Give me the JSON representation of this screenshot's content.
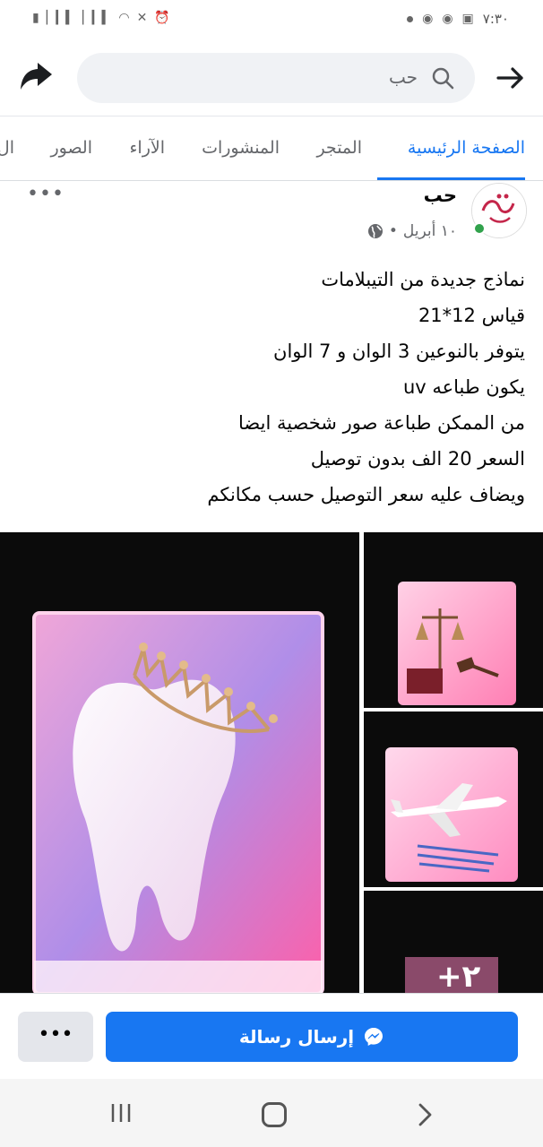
{
  "status_bar": {
    "time": "٧:٣٠"
  },
  "search": {
    "query": "حب"
  },
  "tabs": [
    {
      "label": "الصفحة الرئيسية",
      "active": true
    },
    {
      "label": "المتجر",
      "active": false
    },
    {
      "label": "المنشورات",
      "active": false
    },
    {
      "label": "الآراء",
      "active": false
    },
    {
      "label": "الصور",
      "active": false
    },
    {
      "label": "ال",
      "active": false
    }
  ],
  "post": {
    "page_name": "حب",
    "date": "١٠ أبريل",
    "separator": "•",
    "text_lines": [
      "نماذج جديدة من التيبلامات",
      "قياس  12*21",
      "يتوفر بالنوعين 3 الوان و 7 الوان",
      "يكون طباعه uv",
      "من الممكن طباعة صور شخصية ايضا",
      "السعر 20 الف بدون توصيل",
      "ويضاف عليه سعر التوصيل حسب مكانكم"
    ],
    "more_photos_label": "+٢"
  },
  "actions": {
    "send_message_label": "إرسال رسالة",
    "more_label": "•••"
  },
  "colors": {
    "accent": "#1877f2",
    "online": "#31a24c"
  }
}
